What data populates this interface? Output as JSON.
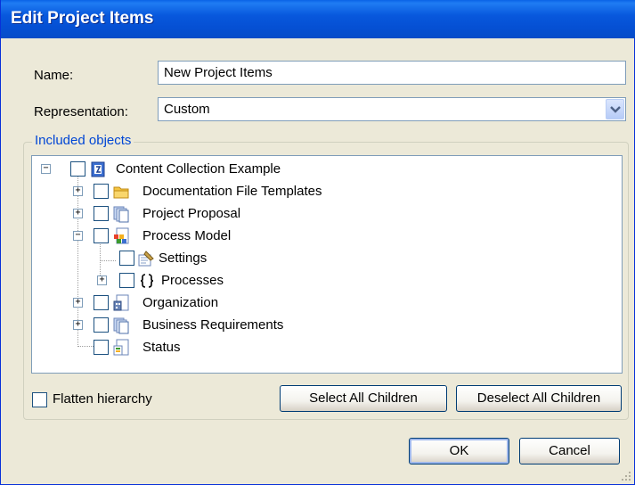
{
  "dialog": {
    "title": "Edit Project Items"
  },
  "form": {
    "name_label": "Name:",
    "name_value": "New Project Items",
    "representation_label": "Representation:",
    "representation_value": "Custom"
  },
  "group": {
    "legend": "Included objects"
  },
  "tree": [
    {
      "label": "Content Collection Example",
      "icon": "content-collection-icon",
      "expander": "minus"
    },
    {
      "label": "Documentation File Templates",
      "icon": "folder-icon",
      "expander": "plus"
    },
    {
      "label": "Project Proposal",
      "icon": "document-stack-icon",
      "expander": "plus"
    },
    {
      "label": "Process Model",
      "icon": "process-model-icon",
      "expander": "minus"
    },
    {
      "label": "Settings",
      "icon": "settings-icon",
      "expander": ""
    },
    {
      "label": "Processes",
      "icon": "braces-icon",
      "expander": "plus"
    },
    {
      "label": "Organization",
      "icon": "organization-icon",
      "expander": "plus"
    },
    {
      "label": "Business Requirements",
      "icon": "document-stack-icon",
      "expander": "plus"
    },
    {
      "label": "Status",
      "icon": "status-icon",
      "expander": ""
    }
  ],
  "options": {
    "flatten_label": "Flatten hierarchy"
  },
  "buttons": {
    "select_all": "Select All Children",
    "deselect_all": "Deselect All Children",
    "ok": "OK",
    "cancel": "Cancel"
  }
}
